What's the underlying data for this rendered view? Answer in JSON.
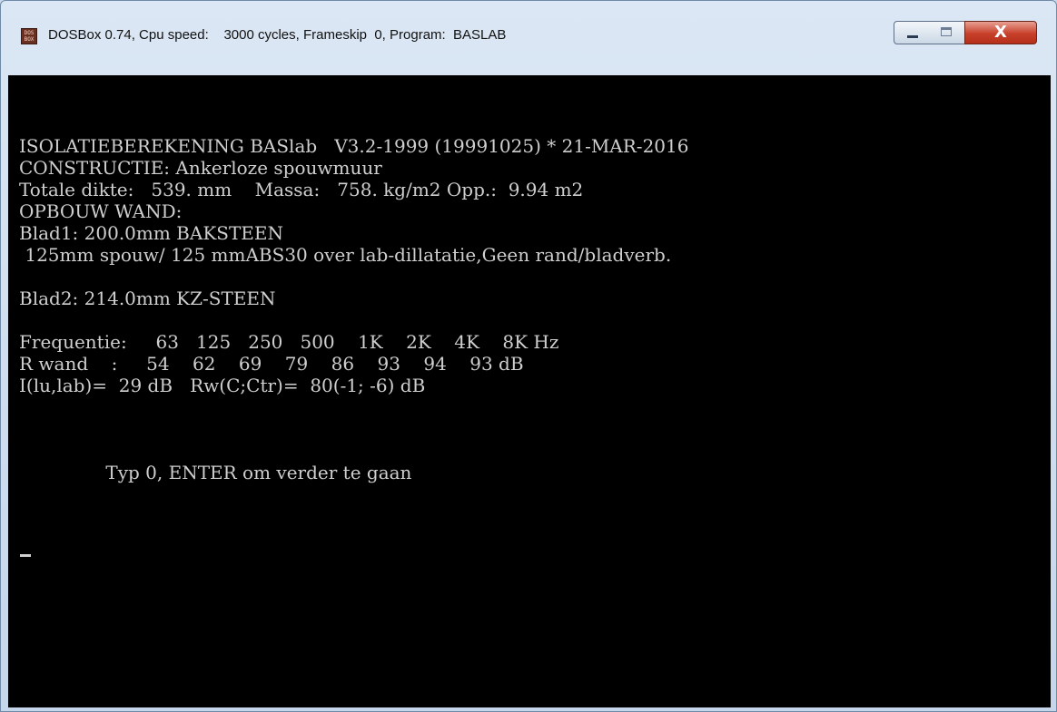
{
  "window": {
    "title": "DOSBox 0.74, Cpu speed:    3000 cycles, Frameskip  0, Program:  BASLAB",
    "app_icon_text": "DOS BOX",
    "close_glyph": "X"
  },
  "console": {
    "lines": [
      "ISOLATIEBEREKENING BASlab   V3.2-1999 (19991025) * 21-MAR-2016",
      "CONSTRUCTIE: Ankerloze spouwmuur",
      "Totale dikte:   539. mm    Massa:   758. kg/m2 Opp.:  9.94 m2",
      "OPBOUW WAND:",
      "Blad1: 200.0mm BAKSTEEN",
      " 125mm spouw/ 125 mmABS30 over lab-dillatatie,Geen rand/bladverb.",
      "Blad2: 214.0mm KZ-STEEN",
      "Frequentie:     63   125   250   500    1K    2K    4K    8K Hz",
      "R wand    :     54    62    69    79    86    93    94    93 dB",
      "I(lu,lab)=  29 dB   Rw(C;Ctr)=  80(-1; -6) dB",
      "               Typ 0, ENTER om verder te gaan"
    ]
  }
}
